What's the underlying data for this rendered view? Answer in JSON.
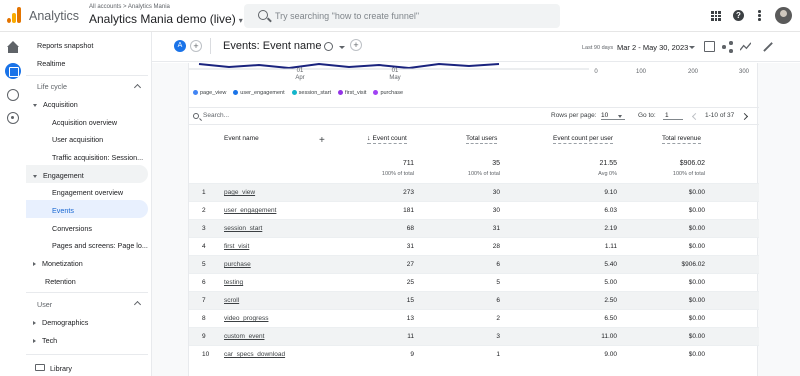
{
  "topbar": {
    "app_name": "Analytics",
    "breadcrumb": "All accounts > Analytics Mania",
    "property": "Analytics Mania demo (live)",
    "search_placeholder": "Try searching \"how to create funnel\""
  },
  "sidebar": {
    "items": [
      {
        "label": "Reports snapshot"
      },
      {
        "label": "Realtime"
      },
      {
        "label": "Life cycle"
      },
      {
        "label": "Acquisition"
      },
      {
        "label": "Acquisition overview"
      },
      {
        "label": "User acquisition"
      },
      {
        "label": "Traffic acquisition: Session..."
      },
      {
        "label": "Engagement"
      },
      {
        "label": "Engagement overview"
      },
      {
        "label": "Events"
      },
      {
        "label": "Conversions"
      },
      {
        "label": "Pages and screens: Page lo..."
      },
      {
        "label": "Monetization"
      },
      {
        "label": "Retention"
      },
      {
        "label": "User"
      },
      {
        "label": "Demographics"
      },
      {
        "label": "Tech"
      },
      {
        "label": "Library"
      }
    ]
  },
  "header": {
    "chip": "A",
    "title": "Events: Event name",
    "range_label": "Last 90 days",
    "range_value": "Mar 2 - May 30, 2023"
  },
  "chart": {
    "x_ticks": [
      {
        "day": "01",
        "month": "Apr"
      },
      {
        "day": "01",
        "month": "May"
      }
    ],
    "right_ticks": [
      "0",
      "100",
      "200",
      "300"
    ],
    "legend": [
      {
        "name": "page_view",
        "color": "#4285f4"
      },
      {
        "name": "user_engagement",
        "color": "#1a73e8"
      },
      {
        "name": "session_start",
        "color": "#12b5cb"
      },
      {
        "name": "first_visit",
        "color": "#9334e6"
      },
      {
        "name": "purchase",
        "color": "#a142f4"
      }
    ]
  },
  "table": {
    "search_placeholder": "Search...",
    "rows_per_page_label": "Rows per page:",
    "rows_per_page": "10",
    "goto_label": "Go to:",
    "goto_value": "1",
    "pagination": "1-10 of 37",
    "columns": {
      "name": "Event name",
      "event_count": "Event count",
      "total_users": "Total users",
      "per_user": "Event count per user",
      "revenue": "Total revenue"
    },
    "totals": {
      "event_count": "711",
      "event_count_sub": "100% of total",
      "total_users": "35",
      "total_users_sub": "100% of total",
      "per_user": "21.55",
      "per_user_sub": "Avg 0%",
      "revenue": "$906.02",
      "revenue_sub": "100% of total"
    },
    "rows": [
      {
        "idx": "1",
        "name": "page_view",
        "count": "273",
        "users": "30",
        "per_user": "9.10",
        "revenue": "$0.00"
      },
      {
        "idx": "2",
        "name": "user_engagement",
        "count": "181",
        "users": "30",
        "per_user": "6.03",
        "revenue": "$0.00"
      },
      {
        "idx": "3",
        "name": "session_start",
        "count": "68",
        "users": "31",
        "per_user": "2.19",
        "revenue": "$0.00"
      },
      {
        "idx": "4",
        "name": "first_visit",
        "count": "31",
        "users": "28",
        "per_user": "1.11",
        "revenue": "$0.00"
      },
      {
        "idx": "5",
        "name": "purchase",
        "count": "27",
        "users": "6",
        "per_user": "5.40",
        "revenue": "$906.02"
      },
      {
        "idx": "6",
        "name": "testing",
        "count": "25",
        "users": "5",
        "per_user": "5.00",
        "revenue": "$0.00"
      },
      {
        "idx": "7",
        "name": "scroll",
        "count": "15",
        "users": "6",
        "per_user": "2.50",
        "revenue": "$0.00"
      },
      {
        "idx": "8",
        "name": "video_progress",
        "count": "13",
        "users": "2",
        "per_user": "6.50",
        "revenue": "$0.00"
      },
      {
        "idx": "9",
        "name": "custom_event",
        "count": "11",
        "users": "3",
        "per_user": "11.00",
        "revenue": "$0.00"
      },
      {
        "idx": "10",
        "name": "car_specs_download",
        "count": "9",
        "users": "1",
        "per_user": "9.00",
        "revenue": "$0.00"
      }
    ]
  }
}
